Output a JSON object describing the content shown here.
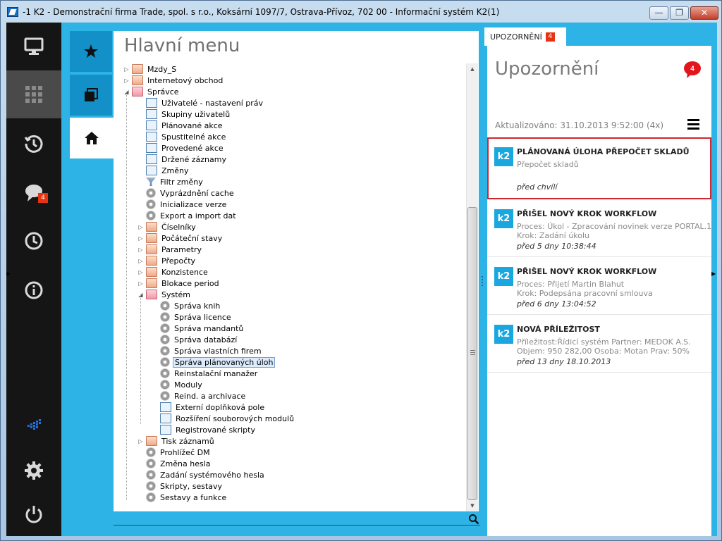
{
  "window": {
    "title": "-1 K2 - Demonstrační firma Trade, spol. s r.o., Koksární 1097/7, Ostrava-Přívoz, 702 00 - Informační systém K2(1)",
    "btn_min": "—",
    "btn_max": "❐",
    "btn_close": "✕"
  },
  "leftbar": {
    "items": [
      "monitor-icon",
      "apps-grid-icon",
      "history-icon",
      "chat-icon",
      "clock-icon",
      "info-icon",
      "k2-logo-icon",
      "gear-icon",
      "power-icon"
    ],
    "chat_badge": "4"
  },
  "tabbar": {
    "items": [
      "star-icon",
      "windows-icon",
      "home-icon"
    ]
  },
  "main_menu": {
    "title": "Hlavní menu",
    "tree": [
      {
        "label": "Mzdy_S",
        "level": 0,
        "icon": "folder",
        "exp": "closed"
      },
      {
        "label": "Internetový obchod",
        "level": 0,
        "icon": "folder",
        "exp": "closed"
      },
      {
        "label": "Správce",
        "level": 0,
        "icon": "folder-open",
        "exp": "open"
      },
      {
        "label": "Uživatelé - nastavení práv",
        "level": 1,
        "icon": "form"
      },
      {
        "label": "Skupiny uživatelů",
        "level": 1,
        "icon": "form"
      },
      {
        "label": "Plánované akce",
        "level": 1,
        "icon": "form"
      },
      {
        "label": "Spustitelné akce",
        "level": 1,
        "icon": "form"
      },
      {
        "label": "Provedené akce",
        "level": 1,
        "icon": "form"
      },
      {
        "label": "Držené záznamy",
        "level": 1,
        "icon": "form"
      },
      {
        "label": "Změny",
        "level": 1,
        "icon": "form"
      },
      {
        "label": "Filtr změny",
        "level": 1,
        "icon": "filter"
      },
      {
        "label": "Vyprázdnění cache",
        "level": 1,
        "icon": "gear"
      },
      {
        "label": "Inicializace verze",
        "level": 1,
        "icon": "gear"
      },
      {
        "label": "Export a import dat",
        "level": 1,
        "icon": "gear"
      },
      {
        "label": "Číselníky",
        "level": 1,
        "icon": "folder",
        "exp": "closed"
      },
      {
        "label": "Počáteční stavy",
        "level": 1,
        "icon": "folder",
        "exp": "closed"
      },
      {
        "label": "Parametry",
        "level": 1,
        "icon": "folder",
        "exp": "closed"
      },
      {
        "label": "Přepočty",
        "level": 1,
        "icon": "folder",
        "exp": "closed"
      },
      {
        "label": "Konzistence",
        "level": 1,
        "icon": "folder",
        "exp": "closed"
      },
      {
        "label": "Blokace period",
        "level": 1,
        "icon": "folder",
        "exp": "closed"
      },
      {
        "label": "Systém",
        "level": 1,
        "icon": "folder-open",
        "exp": "open"
      },
      {
        "label": "Správa knih",
        "level": 2,
        "icon": "gear"
      },
      {
        "label": "Správa licence",
        "level": 2,
        "icon": "gear"
      },
      {
        "label": "Správa mandantů",
        "level": 2,
        "icon": "gear"
      },
      {
        "label": "Správa databází",
        "level": 2,
        "icon": "gear"
      },
      {
        "label": "Správa vlastních firem",
        "level": 2,
        "icon": "gear"
      },
      {
        "label": "Správa plánovaných úloh",
        "level": 2,
        "icon": "gear",
        "selected": true
      },
      {
        "label": "Reinstalační manažer",
        "level": 2,
        "icon": "gear"
      },
      {
        "label": "Moduly",
        "level": 2,
        "icon": "gear"
      },
      {
        "label": "Reind. a archivace",
        "level": 2,
        "icon": "gear"
      },
      {
        "label": "Externí doplňková pole",
        "level": 2,
        "icon": "form"
      },
      {
        "label": "Rozšíření souborových modulů",
        "level": 2,
        "icon": "form"
      },
      {
        "label": "Registrované skripty",
        "level": 2,
        "icon": "form"
      },
      {
        "label": "Tisk záznamů",
        "level": 1,
        "icon": "folder",
        "exp": "closed"
      },
      {
        "label": "Prohlížeč DM",
        "level": 1,
        "icon": "gear"
      },
      {
        "label": "Změna hesla",
        "level": 1,
        "icon": "gear"
      },
      {
        "label": "Zadání systémového hesla",
        "level": 1,
        "icon": "gear"
      },
      {
        "label": "Skripty, sestavy",
        "level": 1,
        "icon": "gear"
      },
      {
        "label": "Sestavy a funkce",
        "level": 1,
        "icon": "gear"
      }
    ]
  },
  "notifications": {
    "tab_label": "UPOZORNĚNÍ",
    "tab_count": "4",
    "title": "Upozornění",
    "bubble_count": "4",
    "updated": "Aktualizováno: 31.10.2013 9:52:00 (4x)",
    "cards": [
      {
        "logo": "k2",
        "title": "PLÁNOVANÁ ÚLOHA PŘEPOČET SKLADŮ",
        "lines": [
          "Přepočet skladů"
        ],
        "time": "před chvílí",
        "highlight": true
      },
      {
        "logo": "k2",
        "title": "PŘIŠEL NOVÝ KROK WORKFLOW",
        "lines": [
          "Proces: Úkol - Zpracování novinek verze PORTAL.1",
          "Krok: Zadání úkolu"
        ],
        "time": "před 5 dny 10:38:44"
      },
      {
        "logo": "k2",
        "title": "PŘIŠEL NOVÝ KROK WORKFLOW",
        "lines": [
          "Proces: Přijetí Martin Blahut",
          "Krok: Podepsána pracovní smlouva"
        ],
        "time": "před 6 dny 13:04:52"
      },
      {
        "logo": "k2",
        "title": "NOVÁ PŘÍLEŽITOST",
        "lines": [
          "Příležitost:Řídicí systém Partner: MEDOK A.S.",
          "Objem: 950 282,00 Osoba: Motan Prav: 50%"
        ],
        "time": "před 13 dny 18.10.2013"
      }
    ]
  },
  "colors": {
    "accent": "#2db3e6",
    "leftbar": "#151515",
    "badge": "#e63312",
    "highlight_border": "#d0262f"
  }
}
